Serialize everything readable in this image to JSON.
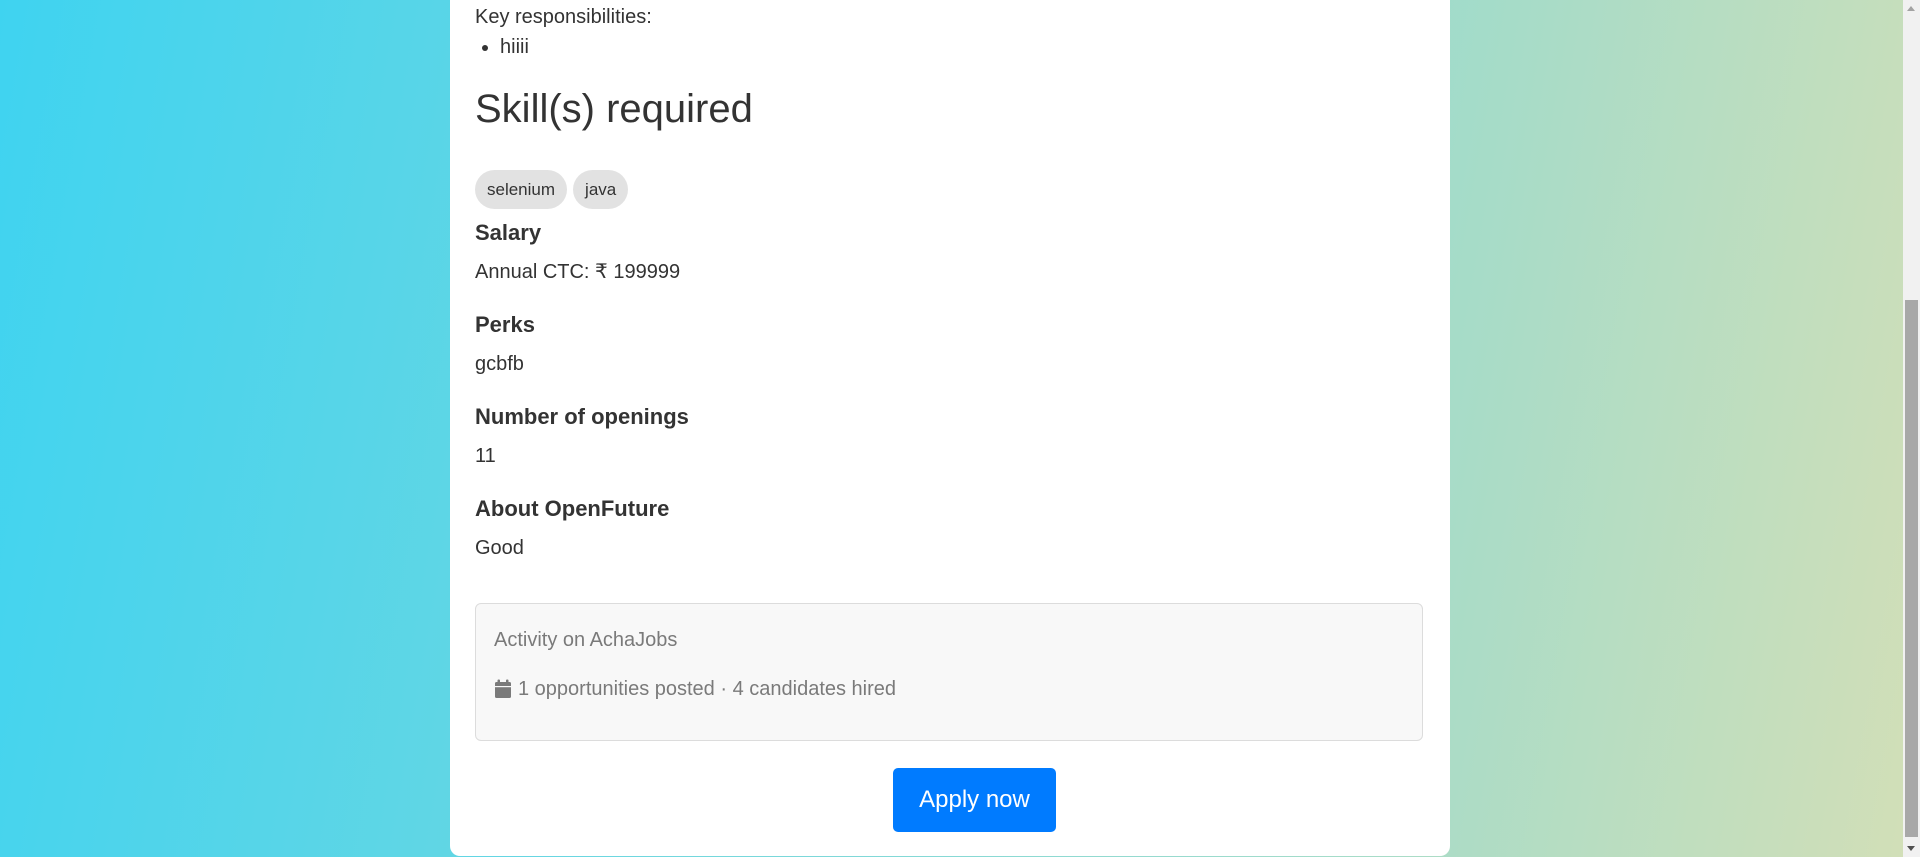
{
  "job": {
    "responsibilities_label": "Key responsibilities:",
    "responsibilities": [
      "hiiii"
    ],
    "skills_heading": "Skill(s) required",
    "skills": [
      "selenium",
      "java"
    ],
    "salary": {
      "heading": "Salary",
      "value": "Annual CTC: ₹ 199999"
    },
    "perks": {
      "heading": "Perks",
      "value": "gcbfb"
    },
    "openings": {
      "heading": "Number of openings",
      "value": "11"
    },
    "about": {
      "heading": "About OpenFuture",
      "value": "Good"
    }
  },
  "activity": {
    "title": "Activity on AchaJobs",
    "icon": "calendar-icon",
    "stats": "1 opportunities posted · 4 candidates hired"
  },
  "apply_button": {
    "label": "Apply now",
    "color": "#007bff"
  },
  "colors": {
    "background_gradient_start": "#3fd3f0",
    "background_gradient_end": "#d3dfb7",
    "card": "#ffffff",
    "chip": "#e2e2e2"
  }
}
